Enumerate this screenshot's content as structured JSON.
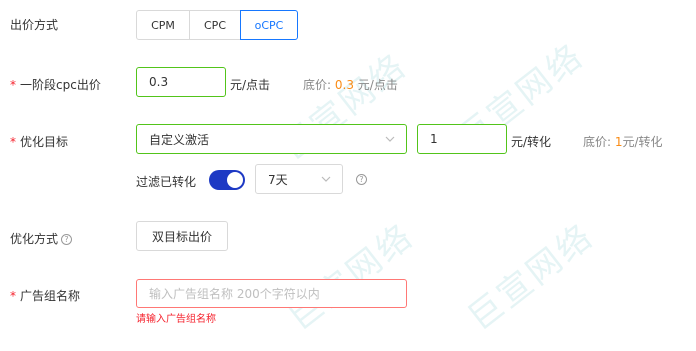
{
  "bid_method": {
    "label": "出价方式",
    "options": [
      "CPM",
      "CPC",
      "oCPC"
    ],
    "selected": "oCPC"
  },
  "first_stage_bid": {
    "label": "一阶段cpc出价",
    "value": "0.3",
    "unit": "元/点击",
    "floor_label": "底价:",
    "floor_value": "0.3",
    "floor_unit": "元/点击"
  },
  "optimization_goal": {
    "label": "优化目标",
    "selected": "自定义激活",
    "value": "1",
    "unit": "元/转化",
    "floor_label": "底价:",
    "floor_value": "1",
    "floor_unit": "元/转化",
    "filter_label": "过滤已转化",
    "filter_on": true,
    "period": "7天"
  },
  "optimization_method": {
    "label": "优化方式",
    "button": "双目标出价"
  },
  "ad_group_name": {
    "label": "广告组名称",
    "placeholder": "输入广告组名称 200个字符以内",
    "error": "请输入广告组名称"
  },
  "watermark": "巨宣网络"
}
